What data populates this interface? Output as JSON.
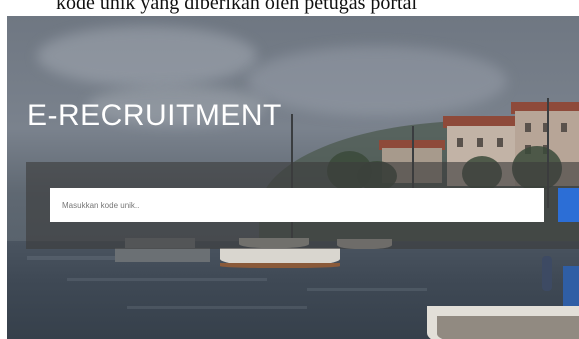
{
  "caption": {
    "text": "kode unik yang diberikan oleh petugas portal"
  },
  "hero": {
    "title": "E-RECRUITMENT"
  },
  "search": {
    "placeholder": "Masukkan kode unik..",
    "value": ""
  },
  "colors": {
    "accent": "#2c6ed6",
    "overlay": "#3c3c3c",
    "title": "#ffffff"
  }
}
